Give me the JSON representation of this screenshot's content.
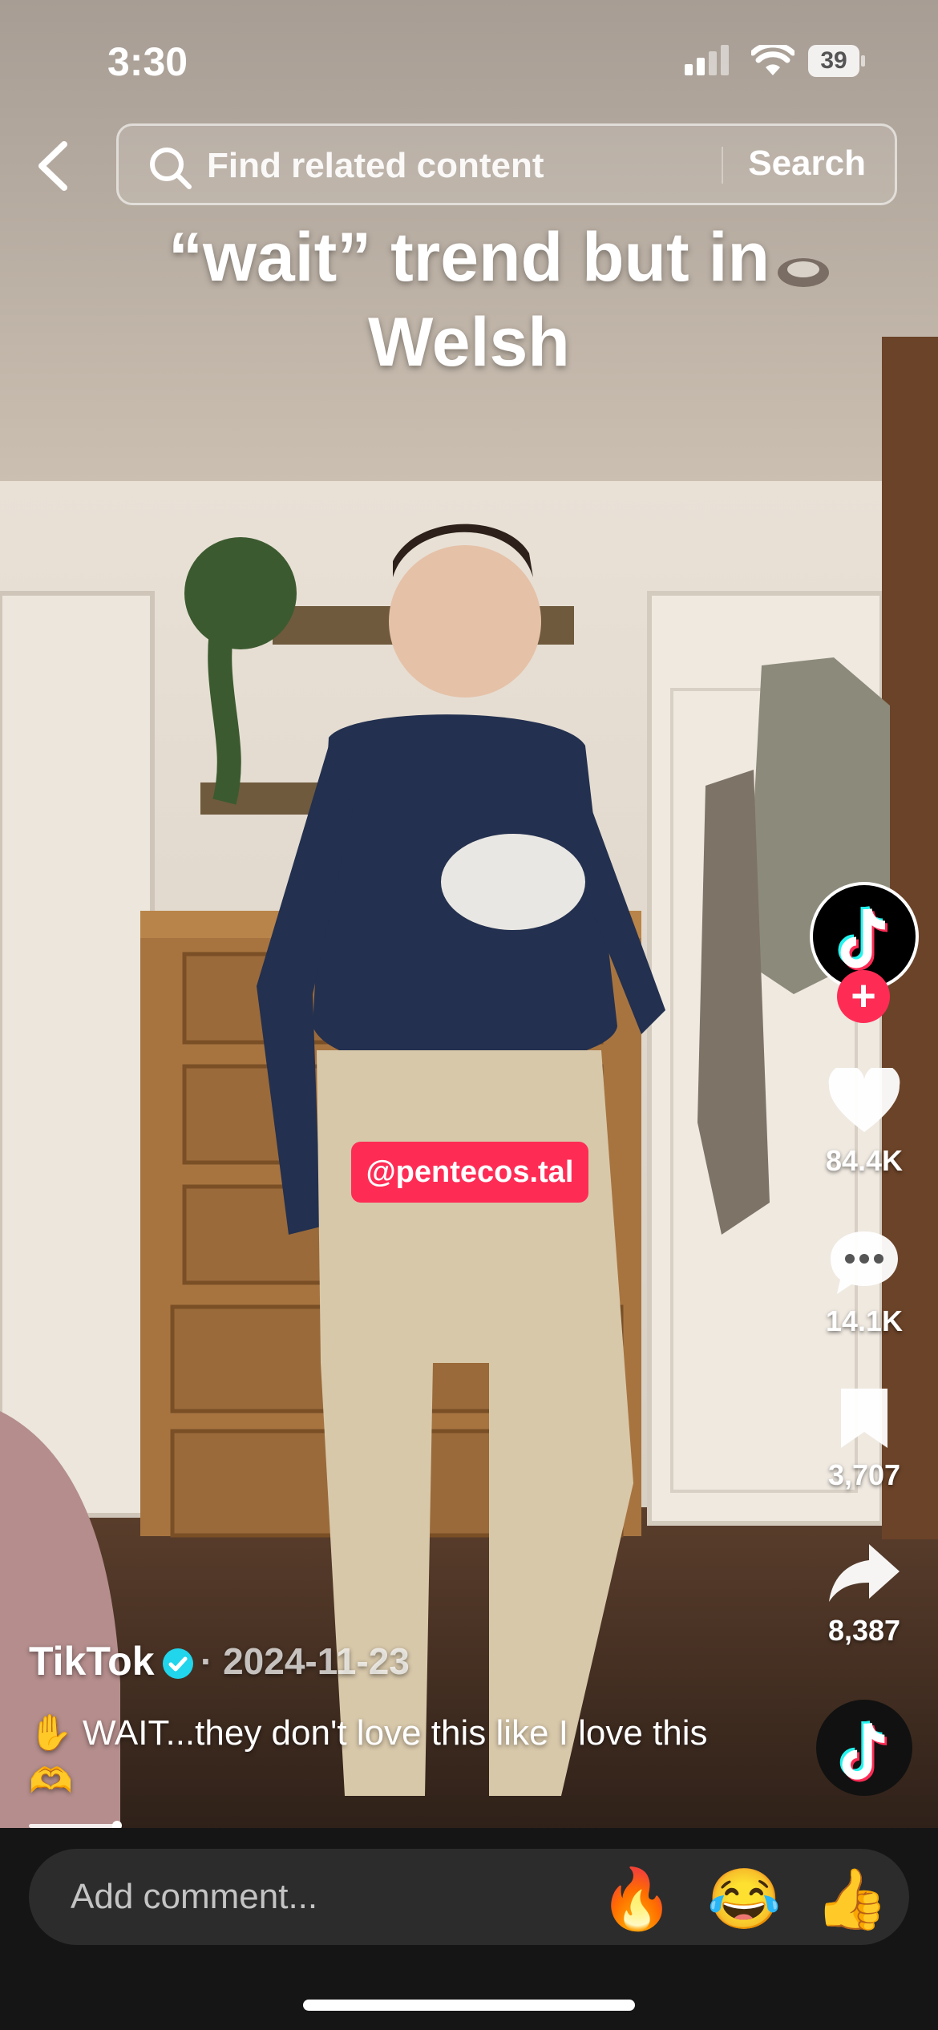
{
  "status_bar": {
    "time": "3:30",
    "battery": "39"
  },
  "search": {
    "placeholder": "Find related content",
    "button_label": "Search"
  },
  "overlay_caption": "“wait” trend but in Welsh",
  "mention_tag": "@pentecos.tal",
  "actions": {
    "likes": "84.4K",
    "comments": "14.1K",
    "saves": "3,707",
    "shares": "8,387",
    "follow_label": "+"
  },
  "post": {
    "author": "TikTok",
    "date": "· 2024-11-23",
    "caption": "✋ WAIT...they don't love this like I love this 🫶"
  },
  "comment_bar": {
    "placeholder": "Add comment...",
    "quick_emojis": [
      "🔥",
      "😂",
      "👍"
    ]
  },
  "progress_fraction": 0.1,
  "colors": {
    "accent": "#fe2c55",
    "verified": "#20d5ec",
    "cyan": "#25f4ee"
  },
  "icons": [
    "back-icon",
    "search-icon",
    "tiktok-logo-icon",
    "heart-icon",
    "comment-icon",
    "bookmark-icon",
    "share-icon",
    "verified-icon"
  ]
}
